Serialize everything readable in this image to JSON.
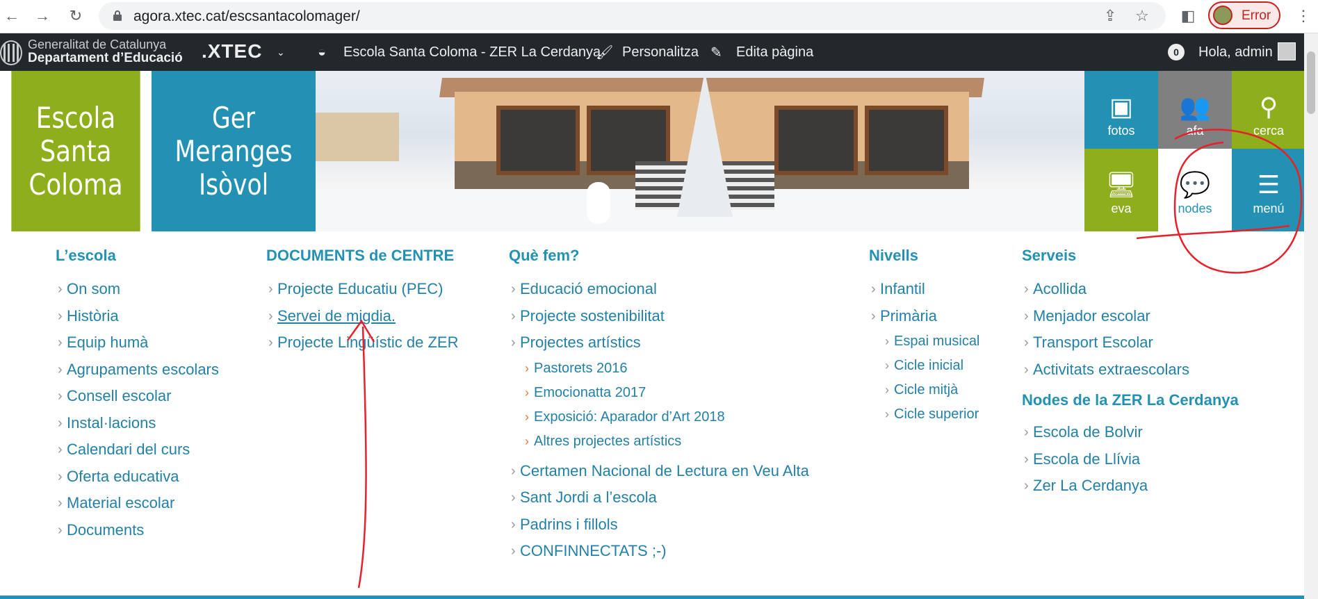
{
  "browser": {
    "url": "agora.xtec.cat/escsantacolomager/",
    "profile_status": "Error"
  },
  "admin_bar": {
    "gencat_line1": "Generalitat de Catalunya",
    "gencat_line2": "Departament d’Educació",
    "xtec": ".XTEC",
    "site_name": "Escola Santa Coloma - ZER La Cerdanya",
    "customize": "Personalitza",
    "edit_page": "Edita pàgina",
    "notifications": "0",
    "greeting": "Hola, admin"
  },
  "header": {
    "school_line1": "Escola",
    "school_line2": "Santa",
    "school_line3": "Coloma",
    "ger_line1": "Ger",
    "ger_line2": "Meranges",
    "ger_line3": "Isòvol",
    "tiles": [
      "fotos",
      "afa",
      "cerca",
      "eva",
      "nodes",
      "menú"
    ]
  },
  "menu": {
    "col1": {
      "heading": "L’escola",
      "items": [
        "On som",
        "Història",
        "Equip humà",
        "Agrupaments escolars",
        "Consell escolar",
        "Instal·lacions",
        "Calendari del curs",
        "Oferta educativa",
        "Material escolar",
        "Documents"
      ]
    },
    "col2": {
      "heading": "DOCUMENTS de CENTRE",
      "items": [
        "Projecte Educatiu (PEC)",
        "Servei de migdia.",
        "Projecte Lingüístic de ZER"
      ]
    },
    "col3": {
      "heading": "Què fem?",
      "items": [
        "Educació emocional",
        "Projecte sostenibilitat",
        "Projectes artístics"
      ],
      "subitems": [
        "Pastorets 2016",
        "Emocionatta 2017",
        "Exposició: Aparador d’Art 2018",
        "Altres projectes artístics"
      ],
      "items_after": [
        "Certamen Nacional de Lectura en Veu Alta",
        "Sant Jordi a l’escola",
        "Padrins i fillols",
        "CONFINNECTATS ;-)"
      ]
    },
    "col4": {
      "heading": "Nivells",
      "items": [
        "Infantil",
        "Primària"
      ],
      "subitems": [
        "Espai musical",
        "Cicle inicial",
        "Cicle mitjà",
        "Cicle superior"
      ]
    },
    "col5": {
      "heading": "Serveis",
      "items": [
        "Acollida",
        "Menjador escolar",
        "Transport Escolar",
        "Activitats extraescolars"
      ],
      "heading2": "Nodes de la ZER La Cerdanya",
      "items2": [
        "Escola de Bolvir",
        "Escola de Llívia",
        "Zer La Cerdanya"
      ]
    }
  },
  "colors": {
    "green": "#8fae1b",
    "teal": "#2391b4",
    "gray": "#808080",
    "adminbar": "#23282d",
    "annotation_red": "#e8202a"
  }
}
